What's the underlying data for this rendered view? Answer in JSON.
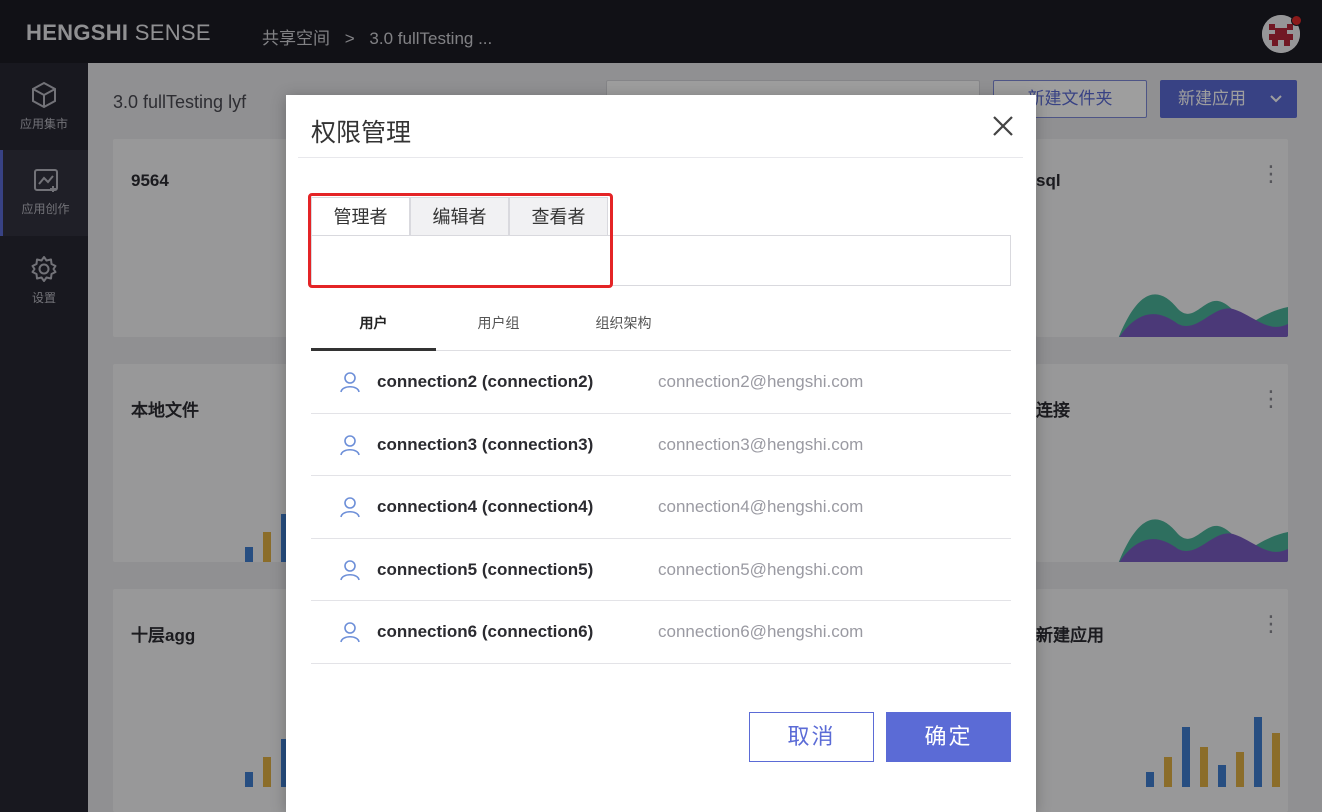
{
  "header": {
    "brand_bold": "HENGSHI",
    "brand_light": "SENSE",
    "breadcrumb": [
      "共享空间",
      ">",
      "3.0 fullTesting ..."
    ]
  },
  "sidebar": {
    "items": [
      {
        "label": "应用集市",
        "icon": "cube-icon"
      },
      {
        "label": "应用创作",
        "icon": "chart-create-icon",
        "active": true
      },
      {
        "label": "设置",
        "icon": "gear-icon"
      }
    ]
  },
  "main": {
    "title": "3.0 fullTesting lyf",
    "new_folder_label": "新建文件夹",
    "new_app_label": "新建应用",
    "cards": [
      {
        "title": "9564"
      },
      {
        "title": "sql"
      },
      {
        "title": "本地文件"
      },
      {
        "title": "连接"
      },
      {
        "title": "十层agg"
      },
      {
        "title": "新建应用"
      }
    ]
  },
  "modal": {
    "title": "权限管理",
    "role_tabs": [
      "管理者",
      "编辑者",
      "查看者"
    ],
    "sub_tabs": [
      "用户",
      "用户组",
      "组织架构"
    ],
    "users": [
      {
        "name": "connection2 (connection2)",
        "email": "connection2@hengshi.com"
      },
      {
        "name": "connection3 (connection3)",
        "email": "connection3@hengshi.com"
      },
      {
        "name": "connection4 (connection4)",
        "email": "connection4@hengshi.com"
      },
      {
        "name": "connection5 (connection5)",
        "email": "connection5@hengshi.com"
      },
      {
        "name": "connection6 (connection6)",
        "email": "connection6@hengshi.com"
      }
    ],
    "cancel_label": "取消",
    "ok_label": "确定"
  },
  "colors": {
    "accent": "#5b6bd6",
    "header_bg": "#1c1c25",
    "sidebar_bg": "#272732",
    "highlight": "#e42426"
  }
}
